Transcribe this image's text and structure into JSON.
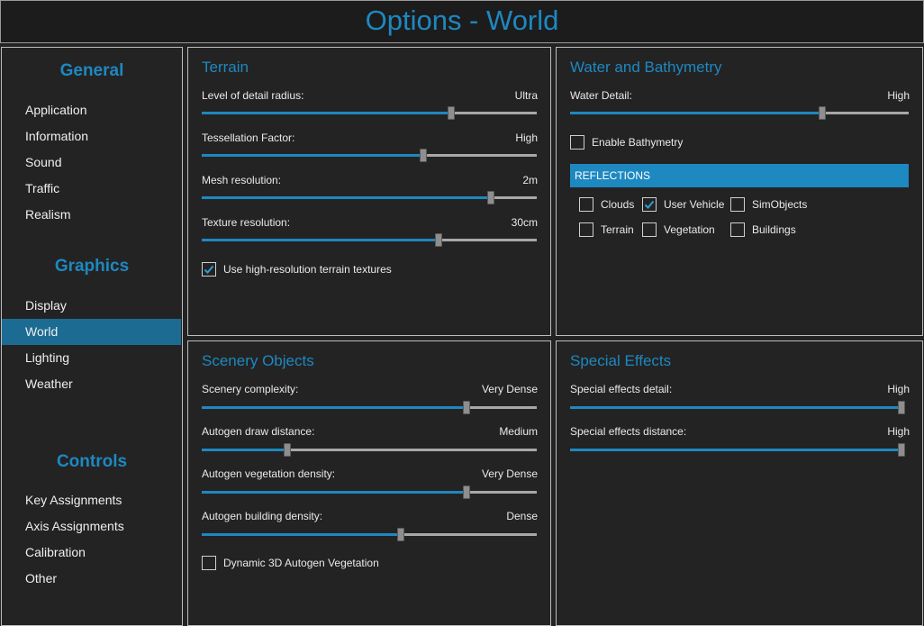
{
  "window": {
    "title": "Options - World"
  },
  "sidebar": {
    "sections": [
      {
        "header": "General",
        "items": [
          "Application",
          "Information",
          "Sound",
          "Traffic",
          "Realism"
        ]
      },
      {
        "header": "Graphics",
        "items": [
          "Display",
          "World",
          "Lighting",
          "Weather"
        ]
      },
      {
        "header": "Controls",
        "items": [
          "Key Assignments",
          "Axis Assignments",
          "Calibration",
          "Other"
        ]
      }
    ],
    "active_item": "World"
  },
  "terrain": {
    "title": "Terrain",
    "sliders": [
      {
        "label": "Level of detail radius:",
        "value_text": "Ultra",
        "level": 0.744
      },
      {
        "label": "Tessellation Factor:",
        "value_text": "High",
        "level": 0.662
      },
      {
        "label": "Mesh resolution:",
        "value_text": "2m",
        "level": 0.863
      },
      {
        "label": "Texture resolution:",
        "value_text": "30cm",
        "level": 0.707
      }
    ],
    "checkbox": {
      "label": "Use high-resolution terrain textures",
      "checked": true
    }
  },
  "water": {
    "title": "Water and Bathymetry",
    "slider": {
      "label": "Water Detail:",
      "value_text": "High",
      "level": 0.744
    },
    "bathymetry": {
      "label": "Enable Bathymetry",
      "checked": false
    },
    "reflections": {
      "header": "REFLECTIONS",
      "options": [
        {
          "label": "Clouds",
          "checked": false
        },
        {
          "label": "User Vehicle",
          "checked": true
        },
        {
          "label": "SimObjects",
          "checked": false
        },
        {
          "label": "Terrain",
          "checked": false
        },
        {
          "label": "Vegetation",
          "checked": false
        },
        {
          "label": "Buildings",
          "checked": false
        }
      ]
    }
  },
  "scenery": {
    "title": "Scenery Objects",
    "sliders": [
      {
        "label": "Scenery complexity:",
        "value_text": "Very Dense",
        "level": 0.791
      },
      {
        "label": "Autogen draw distance:",
        "value_text": "Medium",
        "level": 0.255
      },
      {
        "label": "Autogen vegetation density:",
        "value_text": "Very Dense",
        "level": 0.791
      },
      {
        "label": "Autogen building density:",
        "value_text": "Dense",
        "level": 0.595
      }
    ],
    "checkbox": {
      "label": "Dynamic 3D Autogen Vegetation",
      "checked": false
    }
  },
  "effects": {
    "title": "Special Effects",
    "sliders": [
      {
        "label": "Special effects detail:",
        "value_text": "High",
        "level": 1.0
      },
      {
        "label": "Special effects distance:",
        "value_text": "High",
        "level": 1.0
      }
    ]
  },
  "colors": {
    "accent": "#1e88c0",
    "active_nav": "#1c6b93",
    "background": "#232324"
  }
}
